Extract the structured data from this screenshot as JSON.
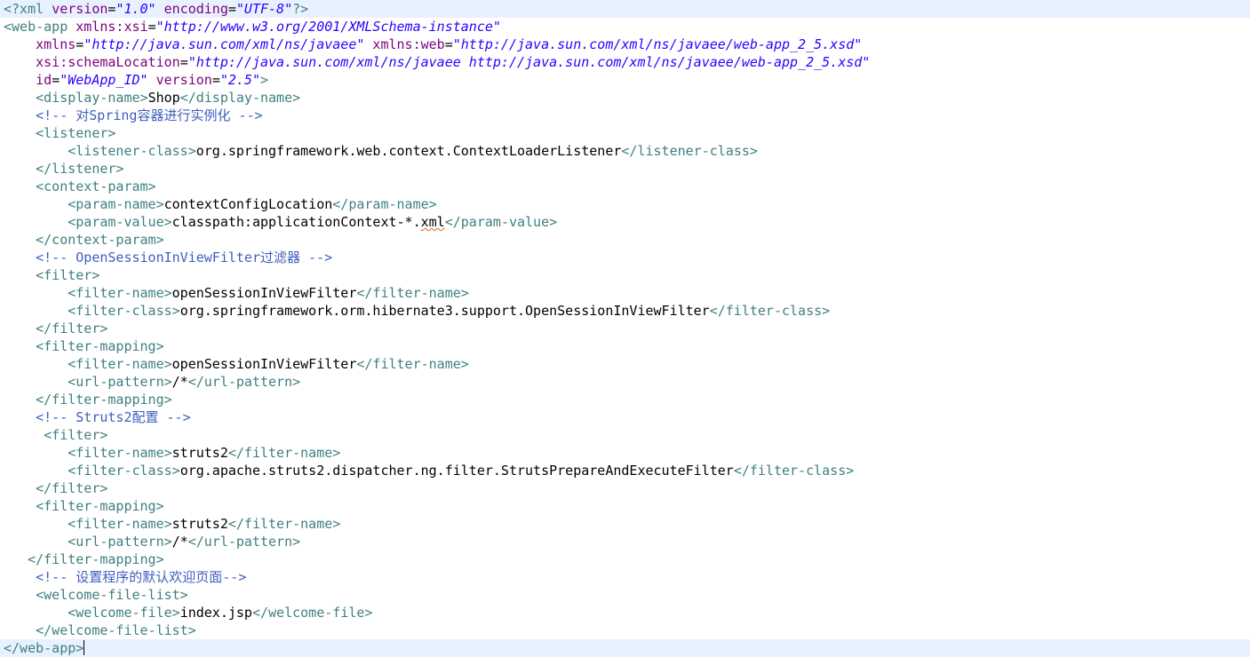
{
  "editor": {
    "lines": [
      [
        {
          "t": "tag",
          "s": "<?xml "
        },
        {
          "t": "attr",
          "s": "version"
        },
        {
          "t": "text",
          "s": "="
        },
        {
          "t": "val",
          "s": "\"1.0\""
        },
        {
          "t": "text",
          "s": " "
        },
        {
          "t": "attr",
          "s": "encoding"
        },
        {
          "t": "text",
          "s": "="
        },
        {
          "t": "val",
          "s": "\"UTF-8\""
        },
        {
          "t": "tag",
          "s": "?>"
        }
      ],
      [
        {
          "t": "tag",
          "s": "<web-app "
        },
        {
          "t": "attr",
          "s": "xmlns:xsi"
        },
        {
          "t": "text",
          "s": "="
        },
        {
          "t": "val",
          "s": "\"http://www.w3.org/2001/XMLSchema-instance\""
        }
      ],
      [
        {
          "t": "text",
          "s": "    "
        },
        {
          "t": "attr",
          "s": "xmlns"
        },
        {
          "t": "text",
          "s": "="
        },
        {
          "t": "val",
          "s": "\"http://java.sun.com/xml/ns/javaee\""
        },
        {
          "t": "text",
          "s": " "
        },
        {
          "t": "attr",
          "s": "xmlns:web"
        },
        {
          "t": "text",
          "s": "="
        },
        {
          "t": "val",
          "s": "\"http://java.sun.com/xml/ns/javaee/web-app_2_5.xsd\""
        }
      ],
      [
        {
          "t": "text",
          "s": "    "
        },
        {
          "t": "attr",
          "s": "xsi:schemaLocation"
        },
        {
          "t": "text",
          "s": "="
        },
        {
          "t": "val",
          "s": "\"http://java.sun.com/xml/ns/javaee http://java.sun.com/xml/ns/javaee/web-app_2_5.xsd\""
        }
      ],
      [
        {
          "t": "text",
          "s": "    "
        },
        {
          "t": "attr",
          "s": "id"
        },
        {
          "t": "text",
          "s": "="
        },
        {
          "t": "val",
          "s": "\"WebApp_ID\""
        },
        {
          "t": "text",
          "s": " "
        },
        {
          "t": "attr",
          "s": "version"
        },
        {
          "t": "text",
          "s": "="
        },
        {
          "t": "val",
          "s": "\"2.5\""
        },
        {
          "t": "tag",
          "s": ">"
        }
      ],
      [
        {
          "t": "text",
          "s": "    "
        },
        {
          "t": "tag",
          "s": "<display-name>"
        },
        {
          "t": "text",
          "s": "Shop"
        },
        {
          "t": "tag",
          "s": "</display-name>"
        }
      ],
      [
        {
          "t": "text",
          "s": "    "
        },
        {
          "t": "comment",
          "s": "<!-- 对Spring容器进行实例化 -->"
        }
      ],
      [
        {
          "t": "text",
          "s": "    "
        },
        {
          "t": "tag",
          "s": "<listener>"
        }
      ],
      [
        {
          "t": "text",
          "s": "        "
        },
        {
          "t": "tag",
          "s": "<listener-class>"
        },
        {
          "t": "text",
          "s": "org.springframework.web.context.ContextLoaderListener"
        },
        {
          "t": "tag",
          "s": "</listener-class>"
        }
      ],
      [
        {
          "t": "text",
          "s": "    "
        },
        {
          "t": "tag",
          "s": "</listener>"
        }
      ],
      [
        {
          "t": "text",
          "s": "    "
        },
        {
          "t": "tag",
          "s": "<context-param>"
        }
      ],
      [
        {
          "t": "text",
          "s": "        "
        },
        {
          "t": "tag",
          "s": "<param-name>"
        },
        {
          "t": "text",
          "s": "contextConfigLocation"
        },
        {
          "t": "tag",
          "s": "</param-name>"
        }
      ],
      [
        {
          "t": "text",
          "s": "        "
        },
        {
          "t": "tag",
          "s": "<param-value>"
        },
        {
          "t": "text",
          "s": "classpath:applicationContext-*."
        },
        {
          "t": "squiggle",
          "s": "xml"
        },
        {
          "t": "tag",
          "s": "</param-value>"
        }
      ],
      [
        {
          "t": "text",
          "s": "    "
        },
        {
          "t": "tag",
          "s": "</context-param>"
        }
      ],
      [
        {
          "t": "text",
          "s": "    "
        },
        {
          "t": "comment",
          "s": "<!-- OpenSessionInViewFilter过滤器 -->"
        }
      ],
      [
        {
          "t": "text",
          "s": "    "
        },
        {
          "t": "tag",
          "s": "<filter>"
        }
      ],
      [
        {
          "t": "text",
          "s": "        "
        },
        {
          "t": "tag",
          "s": "<filter-name>"
        },
        {
          "t": "text",
          "s": "openSessionInViewFilter"
        },
        {
          "t": "tag",
          "s": "</filter-name>"
        }
      ],
      [
        {
          "t": "text",
          "s": "        "
        },
        {
          "t": "tag",
          "s": "<filter-class>"
        },
        {
          "t": "text",
          "s": "org.springframework.orm.hibernate3.support.OpenSessionInViewFilter"
        },
        {
          "t": "tag",
          "s": "</filter-class>"
        }
      ],
      [
        {
          "t": "text",
          "s": "    "
        },
        {
          "t": "tag",
          "s": "</filter>"
        }
      ],
      [
        {
          "t": "text",
          "s": "    "
        },
        {
          "t": "tag",
          "s": "<filter-mapping>"
        }
      ],
      [
        {
          "t": "text",
          "s": "        "
        },
        {
          "t": "tag",
          "s": "<filter-name>"
        },
        {
          "t": "text",
          "s": "openSessionInViewFilter"
        },
        {
          "t": "tag",
          "s": "</filter-name>"
        }
      ],
      [
        {
          "t": "text",
          "s": "        "
        },
        {
          "t": "tag",
          "s": "<url-pattern>"
        },
        {
          "t": "text",
          "s": "/*"
        },
        {
          "t": "tag",
          "s": "</url-pattern>"
        }
      ],
      [
        {
          "t": "text",
          "s": "    "
        },
        {
          "t": "tag",
          "s": "</filter-mapping>"
        }
      ],
      [
        {
          "t": "text",
          "s": "    "
        },
        {
          "t": "comment",
          "s": "<!-- Struts2配置 -->"
        }
      ],
      [
        {
          "t": "text",
          "s": "     "
        },
        {
          "t": "tag",
          "s": "<filter>"
        }
      ],
      [
        {
          "t": "text",
          "s": "        "
        },
        {
          "t": "tag",
          "s": "<filter-name>"
        },
        {
          "t": "text",
          "s": "struts2"
        },
        {
          "t": "tag",
          "s": "</filter-name>"
        }
      ],
      [
        {
          "t": "text",
          "s": "        "
        },
        {
          "t": "tag",
          "s": "<filter-class>"
        },
        {
          "t": "text",
          "s": "org.apache.struts2.dispatcher.ng.filter.StrutsPrepareAndExecuteFilter"
        },
        {
          "t": "tag",
          "s": "</filter-class>"
        }
      ],
      [
        {
          "t": "text",
          "s": "    "
        },
        {
          "t": "tag",
          "s": "</filter>"
        }
      ],
      [
        {
          "t": "text",
          "s": "    "
        },
        {
          "t": "tag",
          "s": "<filter-mapping>"
        }
      ],
      [
        {
          "t": "text",
          "s": "        "
        },
        {
          "t": "tag",
          "s": "<filter-name>"
        },
        {
          "t": "text",
          "s": "struts2"
        },
        {
          "t": "tag",
          "s": "</filter-name>"
        }
      ],
      [
        {
          "t": "text",
          "s": "        "
        },
        {
          "t": "tag",
          "s": "<url-pattern>"
        },
        {
          "t": "text",
          "s": "/*"
        },
        {
          "t": "tag",
          "s": "</url-pattern>"
        }
      ],
      [
        {
          "t": "text",
          "s": "   "
        },
        {
          "t": "tag",
          "s": "</filter-mapping>"
        }
      ],
      [
        {
          "t": "text",
          "s": "    "
        },
        {
          "t": "comment",
          "s": "<!-- 设置程序的默认欢迎页面-->"
        }
      ],
      [
        {
          "t": "text",
          "s": "    "
        },
        {
          "t": "tag",
          "s": "<welcome-file-list>"
        }
      ],
      [
        {
          "t": "text",
          "s": "        "
        },
        {
          "t": "tag",
          "s": "<welcome-file>"
        },
        {
          "t": "text",
          "s": "index.jsp"
        },
        {
          "t": "tag",
          "s": "</welcome-file>"
        }
      ],
      [
        {
          "t": "text",
          "s": "    "
        },
        {
          "t": "tag",
          "s": "</welcome-file-list>"
        }
      ],
      [
        {
          "t": "tag",
          "s": "</web-app>"
        }
      ]
    ],
    "highlighted_lines": [
      0,
      36
    ],
    "caret_line": 36,
    "colors": {
      "tag": "#3f7f7f",
      "attribute": "#7f007f",
      "value": "#2a00ff",
      "comment": "#3f5fbf",
      "text": "#000000",
      "current_line": "#e8f2fe"
    }
  }
}
